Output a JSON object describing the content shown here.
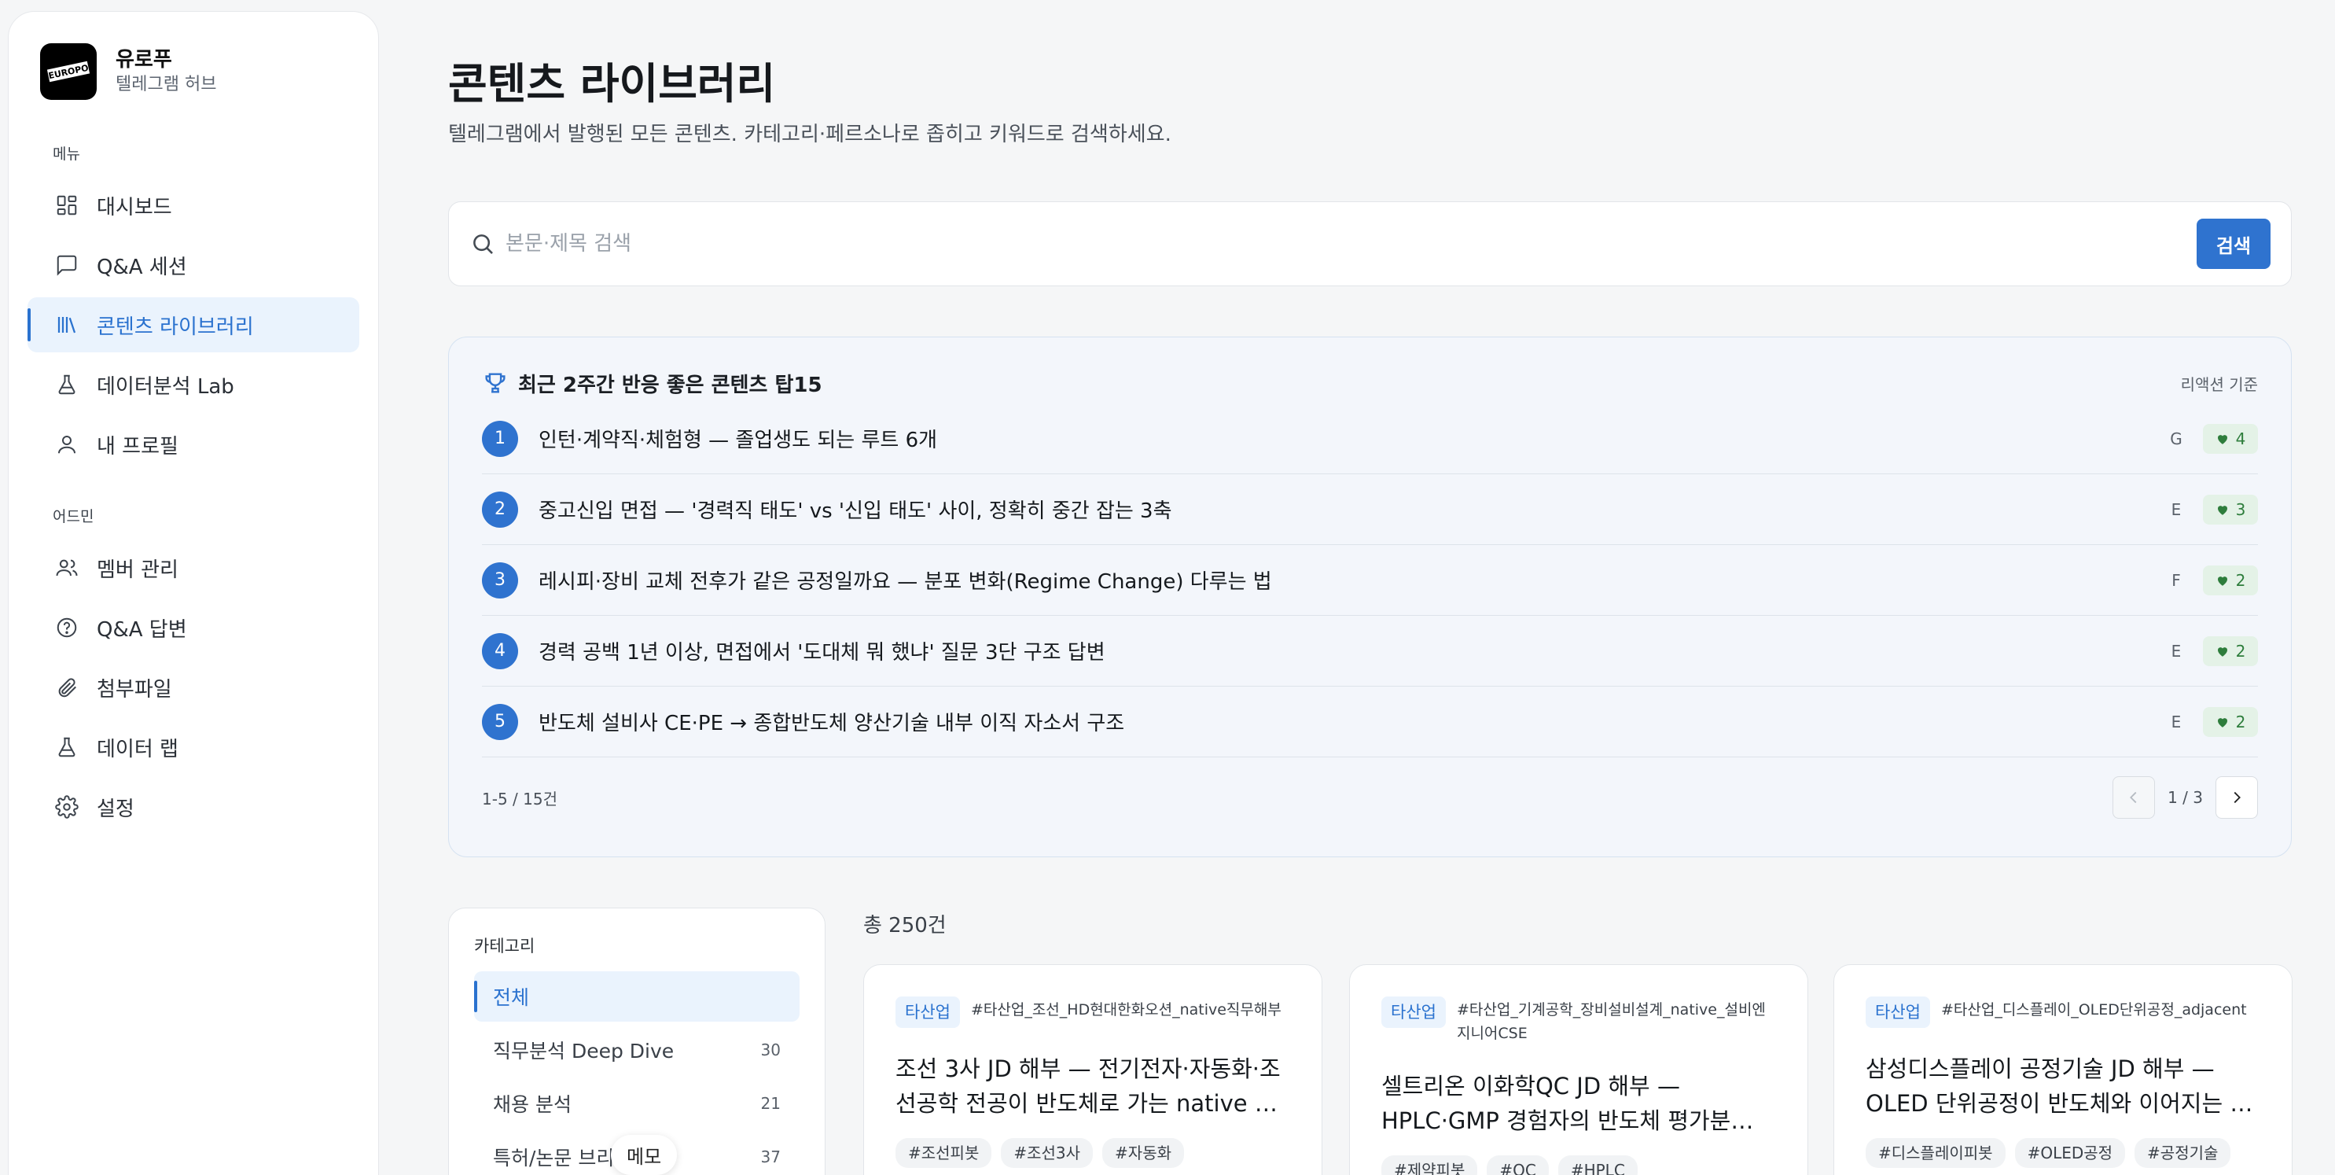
{
  "brand": {
    "name": "유로푸",
    "subtitle": "텔레그램 허브",
    "logo_text": "EUROPO"
  },
  "sidebar": {
    "menu_label": "메뉴",
    "menu_items": [
      {
        "label": "대시보드",
        "icon": "dashboard-icon"
      },
      {
        "label": "Q&A 세션",
        "icon": "chat-icon"
      },
      {
        "label": "콘텐츠 라이브러리",
        "icon": "library-icon",
        "active": true
      },
      {
        "label": "데이터분석 Lab",
        "icon": "flask-icon"
      },
      {
        "label": "내 프로필",
        "icon": "user-icon"
      }
    ],
    "admin_label": "어드민",
    "admin_items": [
      {
        "label": "멤버 관리",
        "icon": "users-icon"
      },
      {
        "label": "Q&A 답변",
        "icon": "help-circle-icon"
      },
      {
        "label": "첨부파일",
        "icon": "paperclip-icon"
      },
      {
        "label": "데이터 랩",
        "icon": "flask-icon"
      },
      {
        "label": "설정",
        "icon": "gear-icon"
      }
    ]
  },
  "page": {
    "title": "콘텐츠 라이브러리",
    "description": "텔레그램에서 발행된 모든 콘텐츠. 카테고리·페르소나로 좁히고 키워드로 검색하세요."
  },
  "search": {
    "placeholder": "본문·제목 검색",
    "value": "",
    "button_label": "검색"
  },
  "top_content": {
    "title": "최근 2주간 반응 좋은 콘텐츠 탑15",
    "note": "리액션 기준",
    "items": [
      {
        "rank": "1",
        "text": "인턴·계약직·체험형 — 졸업생도 되는 루트 6개",
        "category": "G",
        "reactions": "4"
      },
      {
        "rank": "2",
        "text": "중고신입 면접 — '경력직 태도' vs '신입 태도' 사이, 정확히 중간 잡는 3축",
        "category": "E",
        "reactions": "3"
      },
      {
        "rank": "3",
        "text": "레시피·장비 교체 전후가 같은 공정일까요 — 분포 변화(Regime Change) 다루는 법",
        "category": "F",
        "reactions": "2"
      },
      {
        "rank": "4",
        "text": "경력 공백 1년 이상, 면접에서 '도대체 뭐 했냐' 질문 3단 구조 답변",
        "category": "E",
        "reactions": "2"
      },
      {
        "rank": "5",
        "text": "반도체 설비사 CE·PE → 종합반도체 양산기술 내부 이직 자소서 구조",
        "category": "E",
        "reactions": "2"
      }
    ],
    "count_label": "1-5 / 15건",
    "page_label": "1 / 3"
  },
  "categories": {
    "label": "카테고리",
    "items": [
      {
        "label": "전체",
        "count": "",
        "active": true
      },
      {
        "label": "직무분석 Deep Dive",
        "count": "30"
      },
      {
        "label": "채용 분석",
        "count": "21"
      },
      {
        "label": "특허/논문 브리핑",
        "count": "37"
      }
    ],
    "memo_label": "메모"
  },
  "results": {
    "total_label": "총 250건",
    "cards": [
      {
        "badge": "타산업",
        "tagline": "#타산업_조선_HD현대한화오션_native직무해부",
        "title": "조선 3사 JD 해부 — 전기전자·자동화·조선공학 전공이 반도체로 가는 native …",
        "tags": [
          "#조선피봇",
          "#조선3사",
          "#자동화"
        ]
      },
      {
        "badge": "타산업",
        "tagline": "#타산업_기계공학_장비설비설계_native_설비엔지니어CSE",
        "title": "셀트리온 이화학QC JD 해부 — HPLC·GMP 경험자의 반도체 평가분…",
        "tags": [
          "#제약피봇",
          "#QC",
          "#HPLC"
        ]
      },
      {
        "badge": "타산업",
        "tagline": "#타산업_디스플레이_OLED단위공정_adjacent",
        "title": "삼성디스플레이 공정기술 JD 해부 — OLED 단위공정이 반도체와 이어지는 …",
        "tags": [
          "#디스플레이피봇",
          "#OLED공정",
          "#공정기술"
        ]
      }
    ]
  },
  "colors": {
    "accent": "#2f73cf",
    "active_bg": "#eaf3fd",
    "reaction_bg": "#e4f2e7",
    "reaction_fg": "#2e7d3c"
  }
}
